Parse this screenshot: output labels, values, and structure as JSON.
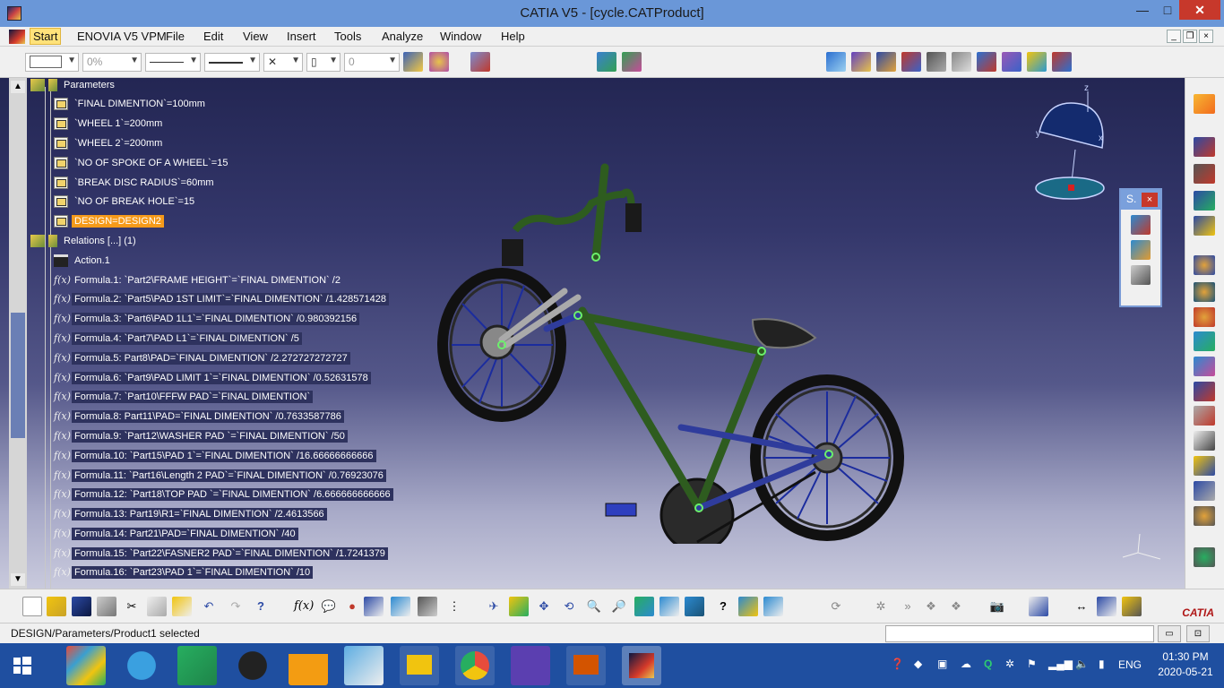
{
  "window": {
    "title": "CATIA V5 - [cycle.CATProduct]",
    "min_label": "—",
    "max_label": "□",
    "close_label": "✕"
  },
  "menu": {
    "items": [
      "Start",
      "ENOVIA V5 VPM",
      "File",
      "Edit",
      "View",
      "Insert",
      "Tools",
      "Analyze",
      "Window",
      "Help"
    ]
  },
  "toolbar": {
    "transparency": "0%",
    "layer_value": "0"
  },
  "tree": {
    "parameters_label": "Parameters",
    "parameters": [
      "`FINAL DIMENTION`=100mm",
      "`WHEEL 1`=200mm",
      "`WHEEL 2`=200mm",
      "`NO OF SPOKE OF A WHEEL`=15",
      "`BREAK DISC RADIUS`=60mm",
      "`NO OF BREAK HOLE`=15",
      "DESIGN=DESIGN2"
    ],
    "relations_label": "Relations [...] (1)",
    "action_label": "Action.1",
    "formulas": [
      "Formula.1: `Part2\\FRAME HEIGHT`=`FINAL DIMENTION` /2",
      "Formula.2: `Part5\\PAD 1ST LIMIT`=`FINAL DIMENTION` /1.428571428",
      "Formula.3: `Part6\\PAD 1L1`=`FINAL DIMENTION` /0.980392156",
      "Formula.4: `Part7\\PAD L1`=`FINAL DIMENTION` /5",
      "Formula.5: Part8\\PAD=`FINAL DIMENTION` /2.272727272727",
      "Formula.6: `Part9\\PAD LIMIT 1`=`FINAL DIMENTION` /0.52631578",
      "Formula.7: `Part10\\FFFW PAD`=`FINAL DIMENTION`",
      "Formula.8: Part11\\PAD=`FINAL DIMENTION` /0.7633587786",
      "Formula.9: `Part12\\WASHER PAD `=`FINAL DIMENTION` /50",
      "Formula.10: `Part15\\PAD 1`=`FINAL DIMENTION` /16.66666666666",
      "Formula.11: `Part16\\Length 2 PAD`=`FINAL DIMENTION` /0.76923076",
      "Formula.12: `Part18\\TOP PAD `=`FINAL DIMENTION` /6.666666666666",
      "Formula.13: Part19\\R1=`FINAL DIMENTION` /2.4613566",
      "Formula.14: Part21\\PAD=`FINAL DIMENTION` /40",
      "Formula.15: `Part22\\FASNER2 PAD`=`FINAL DIMENTION` /1.7241379",
      "Formula.16: `Part23\\PAD 1`=`FINAL DIMENTION` /10"
    ]
  },
  "compass": {
    "x": "x",
    "y": "y",
    "z": "z"
  },
  "floating_toolbar": {
    "title": "S.",
    "close": "×"
  },
  "status": {
    "text": "DESIGN/Parameters/Product1 selected"
  },
  "catia_logo": "CATIA",
  "taskbar": {
    "lang": "ENG",
    "time": "01:30 PM",
    "date": "2020-05-21"
  },
  "colors": {
    "accent": "#6a97d8",
    "selection": "#f59a1a",
    "close": "#c7382b"
  }
}
